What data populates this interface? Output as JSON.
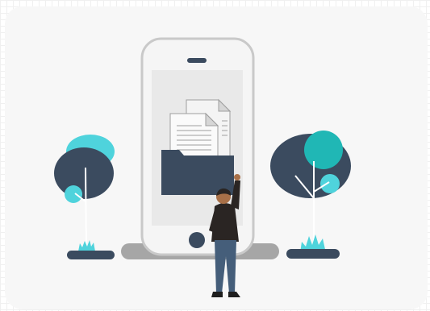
{
  "illustration": {
    "subject": "file-folder-on-phone",
    "colors": {
      "navy": "#3b4b5f",
      "teal": "#20b7b5",
      "cyan": "#4fd3dc",
      "phone_frame": "#f5f5f5",
      "phone_border": "#c9c9c9",
      "screen": "#e9e9e9",
      "shadow": "#a6a6a6",
      "paper": "#f4f4f4",
      "paper_lines": "#bdbdbd",
      "skin": "#a87048",
      "shirt": "#2a2523",
      "jeans": "#455e7a",
      "shoe": "#1e1e1e"
    }
  }
}
